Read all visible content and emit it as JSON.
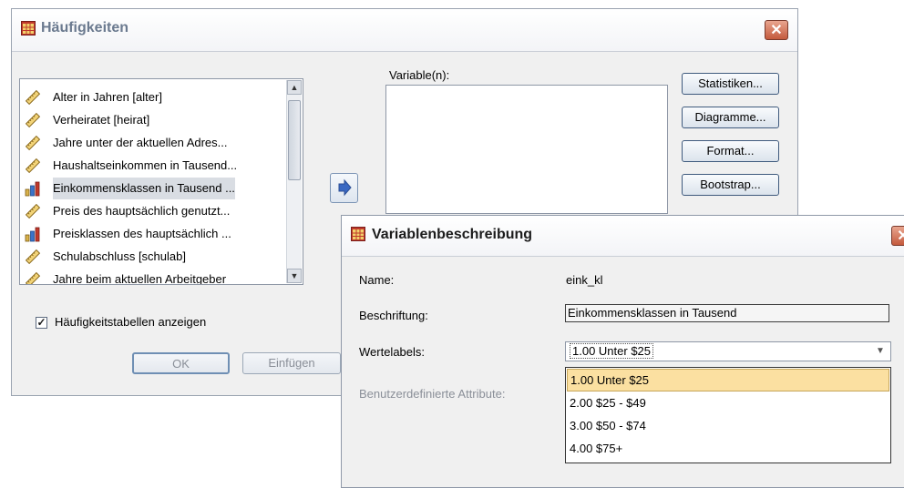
{
  "main_dialog": {
    "title": "Häufigkeiten",
    "variable_list": [
      {
        "label": "Alter in Jahren [alter]",
        "icon": "ruler-icon"
      },
      {
        "label": "Verheiratet [heirat]",
        "icon": "ruler-icon"
      },
      {
        "label": "Jahre unter der aktuellen Adres...",
        "icon": "ruler-icon"
      },
      {
        "label": "Haushaltseinkommen in Tausend...",
        "icon": "ruler-icon"
      },
      {
        "label": "Einkommensklassen in Tausend ...",
        "icon": "ordinal-bars-icon",
        "selected": true
      },
      {
        "label": "Preis des hauptsächlich genutzt...",
        "icon": "ruler-icon"
      },
      {
        "label": "Preisklassen des hauptsächlich ...",
        "icon": "ordinal-bars-icon"
      },
      {
        "label": "Schulabschluss [schulab]",
        "icon": "ruler-icon"
      },
      {
        "label": "Jahre beim aktuellen Arbeitgeber",
        "icon": "ruler-icon"
      }
    ],
    "variables_label": "Variable(n):",
    "buttons": {
      "statistiken": "Statistiken...",
      "diagramme": "Diagramme...",
      "format": "Format...",
      "bootstrap": "Bootstrap...",
      "ok": "OK",
      "einfuegen": "Einfügen"
    },
    "checkbox": {
      "label": "Häufigkeitstabellen anzeigen",
      "checked": true
    }
  },
  "desc_dialog": {
    "title": "Variablenbeschreibung",
    "name_label": "Name:",
    "name_value": "eink_kl",
    "beschriftung_label": "Beschriftung:",
    "beschriftung_value": "Einkommensklassen in Tausend",
    "wertelabels_label": "Wertelabels:",
    "wertelabels_selected": "1.00  Unter $25",
    "attribute_label": "Benutzerdefinierte Attribute:",
    "options": [
      "1.00  Unter $25",
      "2.00  $25 - $49",
      "3.00  $50 - $74",
      "4.00  $75+"
    ]
  },
  "colors": {
    "selection": "#fbe0a1",
    "title_text": "#6b7a8f",
    "close": "#c45a3d"
  }
}
